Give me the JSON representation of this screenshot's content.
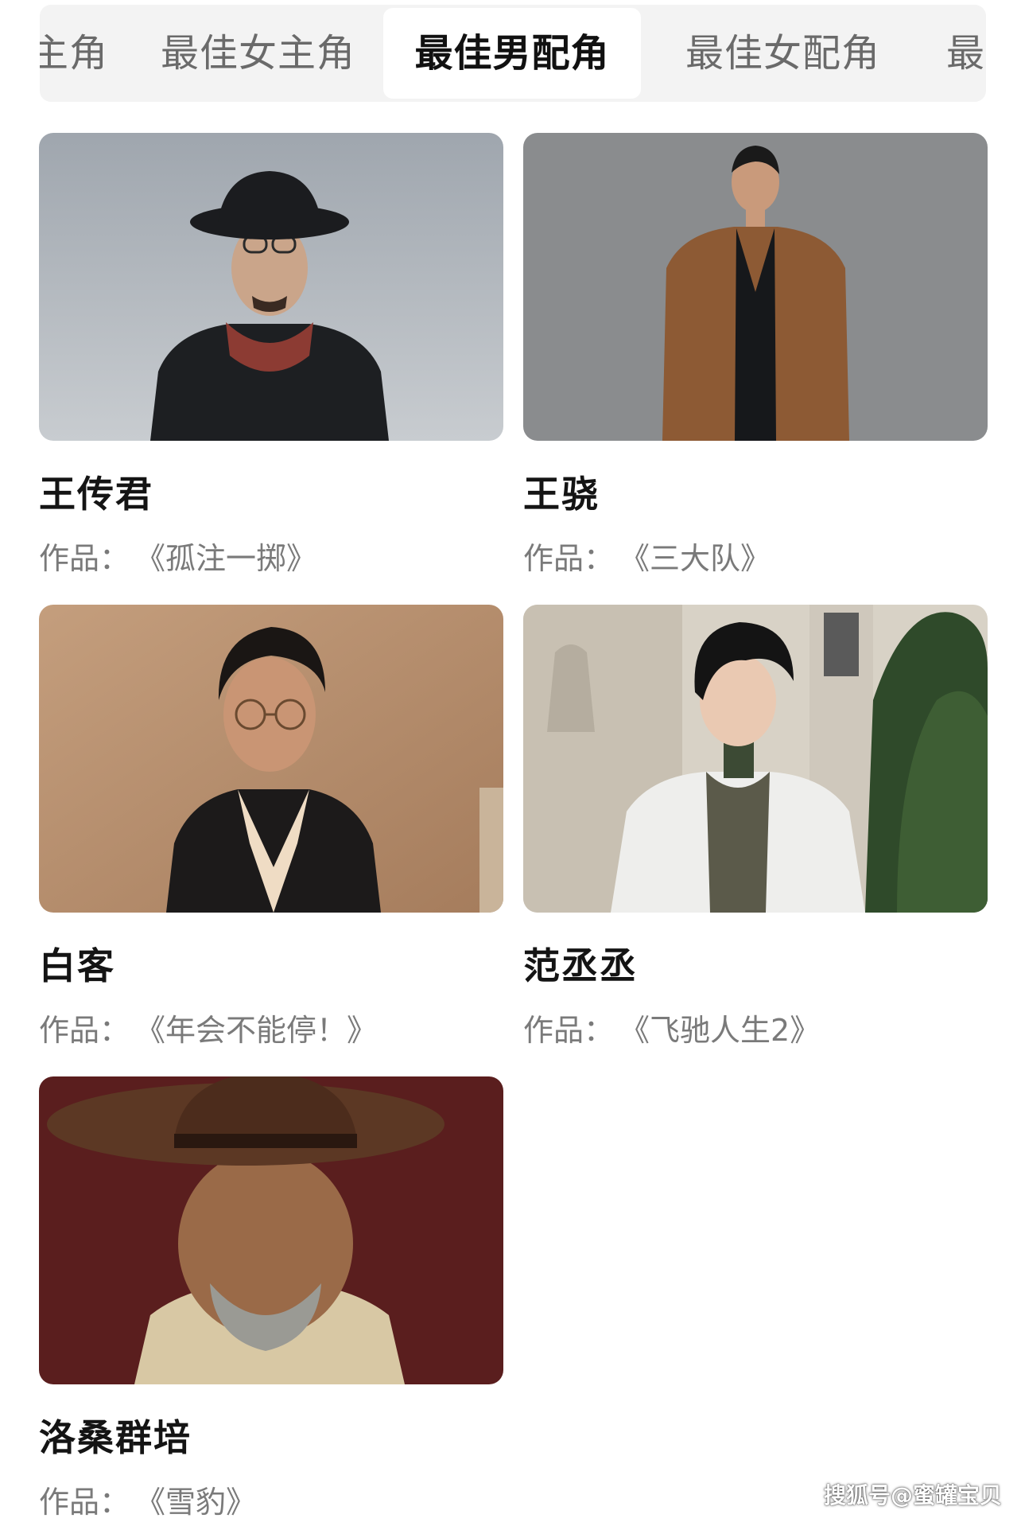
{
  "tabs": [
    {
      "label": "主角",
      "active": false
    },
    {
      "label": "最佳女主角",
      "active": false
    },
    {
      "label": "最佳男配角",
      "active": true
    },
    {
      "label": "最佳女配角",
      "active": false
    },
    {
      "label": "最佳",
      "active": false
    }
  ],
  "work_label": "作品：",
  "nominees": [
    {
      "name": "王传君",
      "work": "《孤注一掷》"
    },
    {
      "name": "王骁",
      "work": "《三大队》"
    },
    {
      "name": "白客",
      "work": "《年会不能停！》"
    },
    {
      "name": "范丞丞",
      "work": "《飞驰人生2》"
    },
    {
      "name": "洛桑群培",
      "work": "《雪豹》"
    }
  ],
  "watermark": "搜狐号@蜜罐宝贝",
  "colors": {
    "tabbar_bg": "#f3f3f3",
    "active_tab_bg": "#ffffff",
    "inactive_tab_text": "#6a6a6a",
    "name_text": "#141414",
    "work_text": "#7a7a7a"
  }
}
